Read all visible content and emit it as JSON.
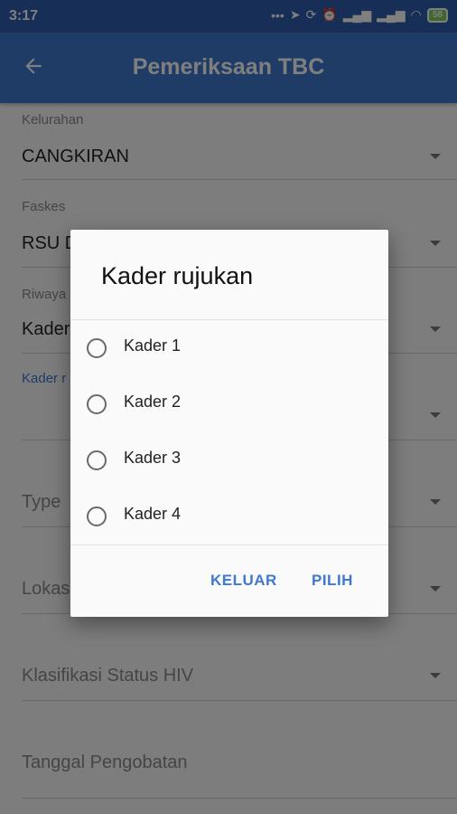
{
  "status_bar": {
    "time": "3:17",
    "battery": "58"
  },
  "app_bar": {
    "title": "Pemeriksaan TBC"
  },
  "form": {
    "kelurahan": {
      "label": "Kelurahan",
      "value": "CANGKIRAN"
    },
    "faskes": {
      "label": "Faskes",
      "value": "RSU D"
    },
    "riwayat": {
      "label": "Riwaya",
      "value": "Kader"
    },
    "kader_link": {
      "label": "Kader r"
    },
    "type": {
      "placeholder": "Type"
    },
    "lokasi": {
      "placeholder": "Lokas"
    },
    "klasifikasi": {
      "placeholder": "Klasifikasi Status HIV"
    },
    "tanggal": {
      "placeholder": "Tanggal Pengobatan"
    }
  },
  "dialog": {
    "title": "Kader rujukan",
    "options": [
      "Kader 1",
      "Kader 2",
      "Kader 3",
      "Kader 4"
    ],
    "cancel_label": "KELUAR",
    "ok_label": "PILIH"
  },
  "colors": {
    "app_bar": "#3f78cf",
    "status_bar": "#2f5cae",
    "accent": "#3f78cf"
  }
}
